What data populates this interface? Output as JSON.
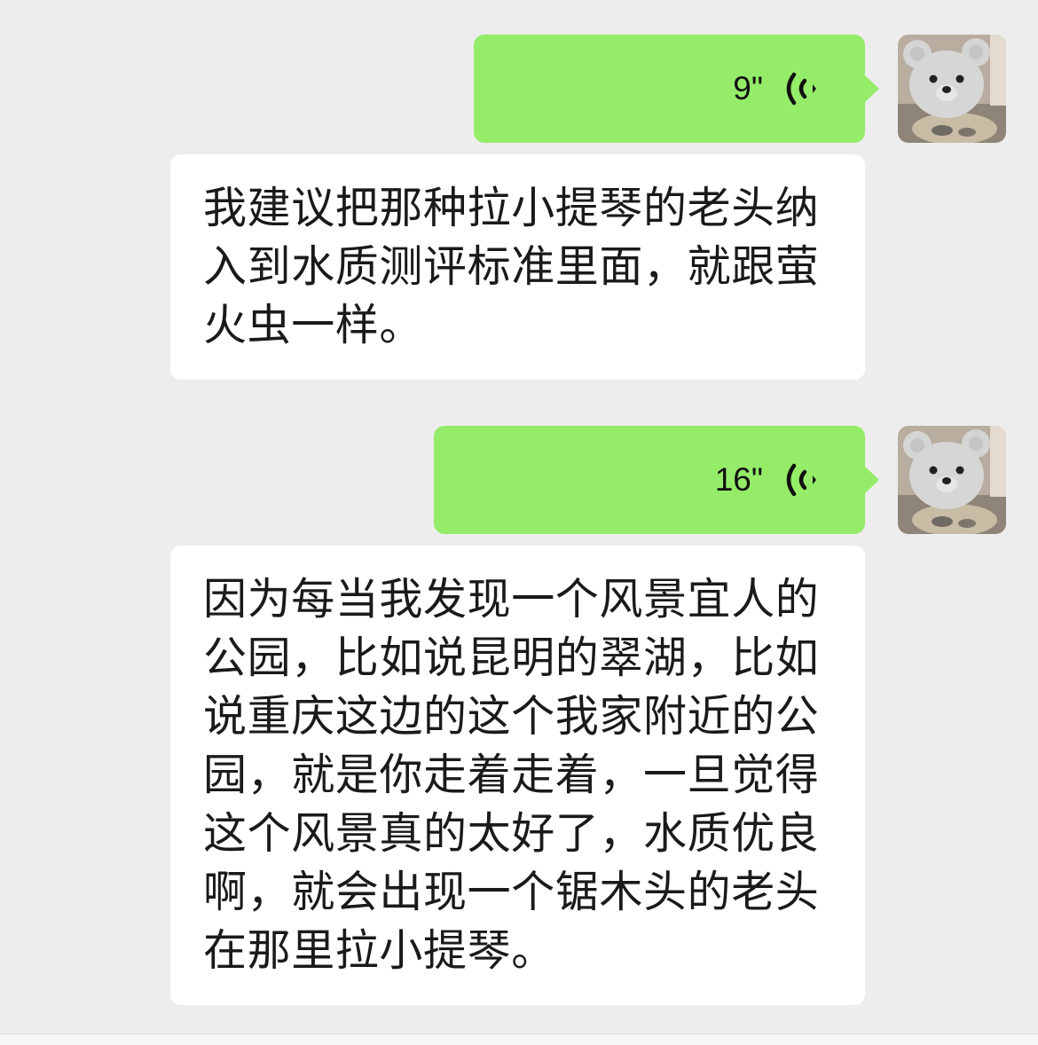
{
  "colors": {
    "background": "#ededed",
    "self_bubble": "#95ec69",
    "other_bubble": "#ffffff",
    "text": "#1a1a1a"
  },
  "messages": [
    {
      "type": "voice",
      "sender": "self",
      "duration": "9\"",
      "icon": "voice-wave-icon"
    },
    {
      "type": "text",
      "sender": "other",
      "text": "我建议把那种拉小提琴的老头纳入到水质测评标准里面，就跟萤火虫一样。"
    },
    {
      "type": "voice",
      "sender": "self",
      "duration": "16\"",
      "icon": "voice-wave-icon"
    },
    {
      "type": "text",
      "sender": "other",
      "text": "因为每当我发现一个风景宜人的公园，比如说昆明的翠湖，比如说重庆这边的这个我家附近的公园，就是你走着走着，一旦觉得这个风景真的太好了，水质优良啊，就会出现一个锯木头的老头在那里拉小提琴。"
    }
  ]
}
